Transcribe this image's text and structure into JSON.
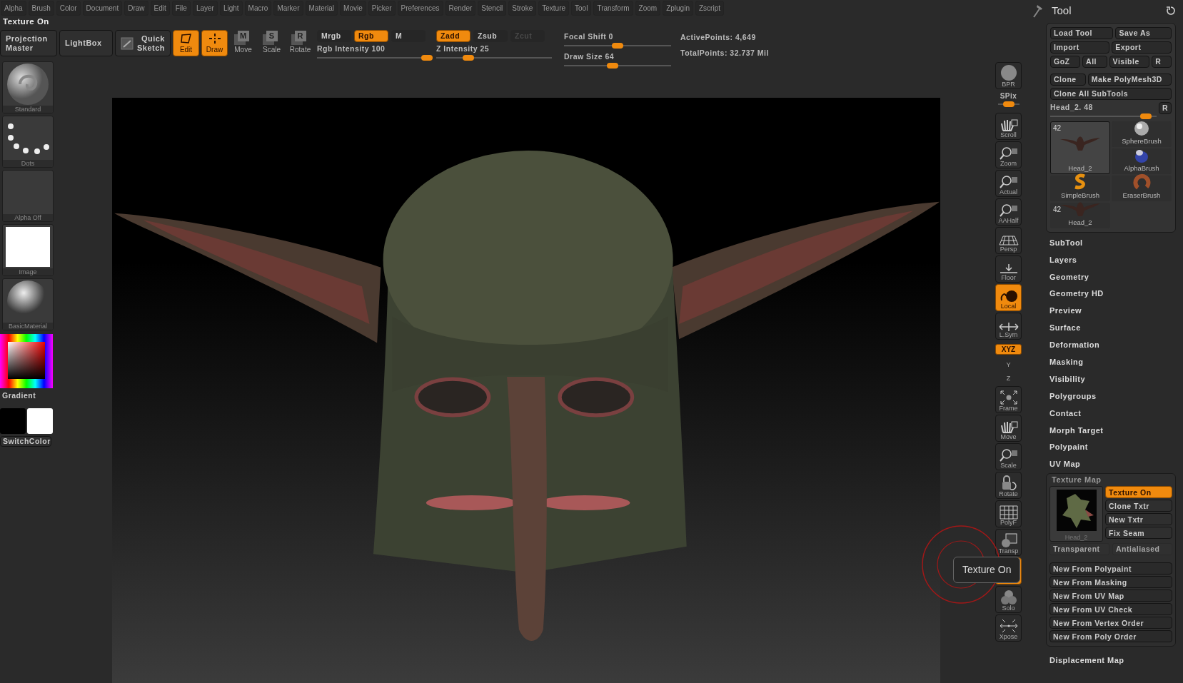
{
  "menu": [
    "Alpha",
    "Brush",
    "Color",
    "Document",
    "Draw",
    "Edit",
    "File",
    "Layer",
    "Light",
    "Macro",
    "Marker",
    "Material",
    "Movie",
    "Picker",
    "Preferences",
    "Render",
    "Stencil",
    "Stroke",
    "Texture",
    "Tool",
    "Transform",
    "Zoom",
    "Zplugin",
    "Zscript"
  ],
  "status_title": "Texture On",
  "toolbar": {
    "projection_master": "Projection Master",
    "lightbox": "LightBox",
    "quick_sketch": "Quick Sketch",
    "modes": [
      {
        "kind": "edit",
        "label": "Edit",
        "selected": true
      },
      {
        "kind": "draw",
        "label": "Draw",
        "selected": true
      },
      {
        "kind": "letter",
        "glyph": "M",
        "label": "Move",
        "selected": false
      },
      {
        "kind": "letter",
        "glyph": "S",
        "label": "Scale",
        "selected": false
      },
      {
        "kind": "letter",
        "glyph": "R",
        "label": "Rotate",
        "selected": false
      }
    ],
    "color_modes": [
      {
        "label": "Mrgb",
        "selected": false
      },
      {
        "label": "Rgb",
        "selected": true
      },
      {
        "label": "M",
        "selected": false
      }
    ],
    "rgb_intensity": {
      "label": "Rgb Intensity 100",
      "level": 1
    },
    "depth_modes": [
      {
        "label": "Zadd",
        "selected": true,
        "disabled": false
      },
      {
        "label": "Zsub",
        "selected": false,
        "disabled": false
      },
      {
        "label": "Zcut",
        "selected": false,
        "disabled": true
      }
    ],
    "z_intensity": {
      "label": "Z Intensity 25",
      "level": 0.25
    },
    "focal_shift": {
      "label": "Focal Shift 0",
      "level": 0.5
    },
    "draw_size": {
      "label": "Draw Size 64",
      "level": 0.45
    },
    "stats": [
      "ActivePoints: 4,649",
      "TotalPoints: 32.737 Mil"
    ]
  },
  "left_shelf": [
    {
      "kind": "sphere",
      "label": "Standard"
    },
    {
      "kind": "dots",
      "label": "Dots"
    },
    {
      "kind": "empty",
      "label": "Alpha Off"
    },
    {
      "kind": "white",
      "label": "Image"
    },
    {
      "kind": "material",
      "label": "BasicMaterial"
    }
  ],
  "color_picker": {
    "label": "Gradient"
  },
  "swatches": {
    "colors": [
      {
        "color": "#000000"
      },
      {
        "color": "#ffffff"
      }
    ],
    "label": "SwitchColor"
  },
  "dock": [
    {
      "kind": "tile",
      "label": "BPR",
      "active": false
    },
    {
      "kind": "slider",
      "label": "SPix",
      "level": 0.5
    },
    {
      "kind": "tile",
      "label": "Scroll",
      "active": false
    },
    {
      "kind": "tile",
      "label": "Zoom",
      "active": false
    },
    {
      "kind": "tile",
      "label": "Actual",
      "active": false
    },
    {
      "kind": "tile",
      "label": "AAHalf",
      "active": false
    },
    {
      "kind": "tile",
      "label": "Persp",
      "active": false
    },
    {
      "kind": "tile",
      "label": "Floor",
      "active": false
    },
    {
      "kind": "tile",
      "label": "Local",
      "active": true
    },
    {
      "kind": "tile",
      "label": "L.Sym",
      "active": false
    },
    {
      "kind": "pill",
      "label": "XYZ",
      "active": true
    },
    {
      "kind": "mini",
      "label": "Y",
      "active": false
    },
    {
      "kind": "mini",
      "label": "Z",
      "active": false
    },
    {
      "kind": "tile",
      "label": "Frame",
      "active": false
    },
    {
      "kind": "tile",
      "label": "Move",
      "active": false
    },
    {
      "kind": "tile",
      "label": "Scale",
      "active": false
    },
    {
      "kind": "tile",
      "label": "Rotate",
      "active": false
    },
    {
      "kind": "tile",
      "label": "PolyF",
      "active": false
    },
    {
      "kind": "tile",
      "label": "Transp",
      "active": false
    },
    {
      "kind": "tile",
      "active": true
    },
    {
      "kind": "tile",
      "label": "Solo",
      "active": false
    },
    {
      "kind": "tile",
      "label": "Xpose",
      "active": false
    }
  ],
  "tooltip": {
    "text": "Texture On"
  },
  "tool_panel": {
    "title": "Tool",
    "button_rows": [
      [
        "Load Tool",
        "Save As"
      ],
      [
        "Import",
        "Export"
      ],
      [
        "GoZ",
        "All",
        "Visible",
        "R"
      ],
      [
        "Clone",
        "Make PolyMesh3D"
      ],
      [
        "Clone All SubTools"
      ]
    ],
    "current_tool": {
      "label": "Head_2. 48",
      "level": 0.95,
      "reset": "R"
    },
    "tools": [
      {
        "kind": "mesh",
        "name": "Head_2",
        "count": "42",
        "selected": true
      },
      {
        "kind": "sphere",
        "name": "SphereBrush",
        "selected": false
      },
      {
        "kind": "alpha",
        "name": "AlphaBrush",
        "selected": false
      },
      {
        "kind": "simple",
        "name": "SimpleBrush",
        "selected": false
      },
      {
        "kind": "eraser",
        "name": "EraserBrush",
        "selected": false
      },
      {
        "kind": "mesh",
        "name": "Head_2",
        "count": "42",
        "selected": false
      }
    ],
    "sections": [
      {
        "label": "SubTool",
        "expanded": false
      },
      {
        "label": "Layers",
        "expanded": false
      },
      {
        "label": "Geometry",
        "expanded": false
      },
      {
        "label": "Geometry HD",
        "expanded": false
      },
      {
        "label": "Preview",
        "expanded": false
      },
      {
        "label": "Surface",
        "expanded": false
      },
      {
        "label": "Deformation",
        "expanded": false
      },
      {
        "label": "Masking",
        "expanded": false
      },
      {
        "label": "Visibility",
        "expanded": false
      },
      {
        "label": "Polygroups",
        "expanded": false
      },
      {
        "label": "Contact",
        "expanded": false
      },
      {
        "label": "Morph Target",
        "expanded": false
      },
      {
        "label": "Polypaint",
        "expanded": false
      },
      {
        "label": "UV Map",
        "expanded": false
      },
      {
        "label": "Texture Map",
        "expanded": true
      },
      {
        "label": "Displacement Map",
        "expanded": false
      }
    ],
    "texture_map": {
      "thumbnail_label": "Head_2",
      "buttons": [
        {
          "label": "Texture On",
          "on": true
        },
        {
          "label": "Clone Txtr",
          "on": false
        },
        {
          "label": "New Txtr",
          "on": false
        },
        {
          "label": "Fix Seam",
          "on": false
        }
      ],
      "toggles": [
        {
          "label": "Transparent",
          "on": false
        },
        {
          "label": "Antialiased",
          "on": false
        }
      ],
      "new_from": [
        "New From Polypaint",
        "New From Masking",
        "New From UV Map",
        "New From UV Check",
        "New From Vertex Order",
        "New From Poly Order"
      ]
    }
  }
}
